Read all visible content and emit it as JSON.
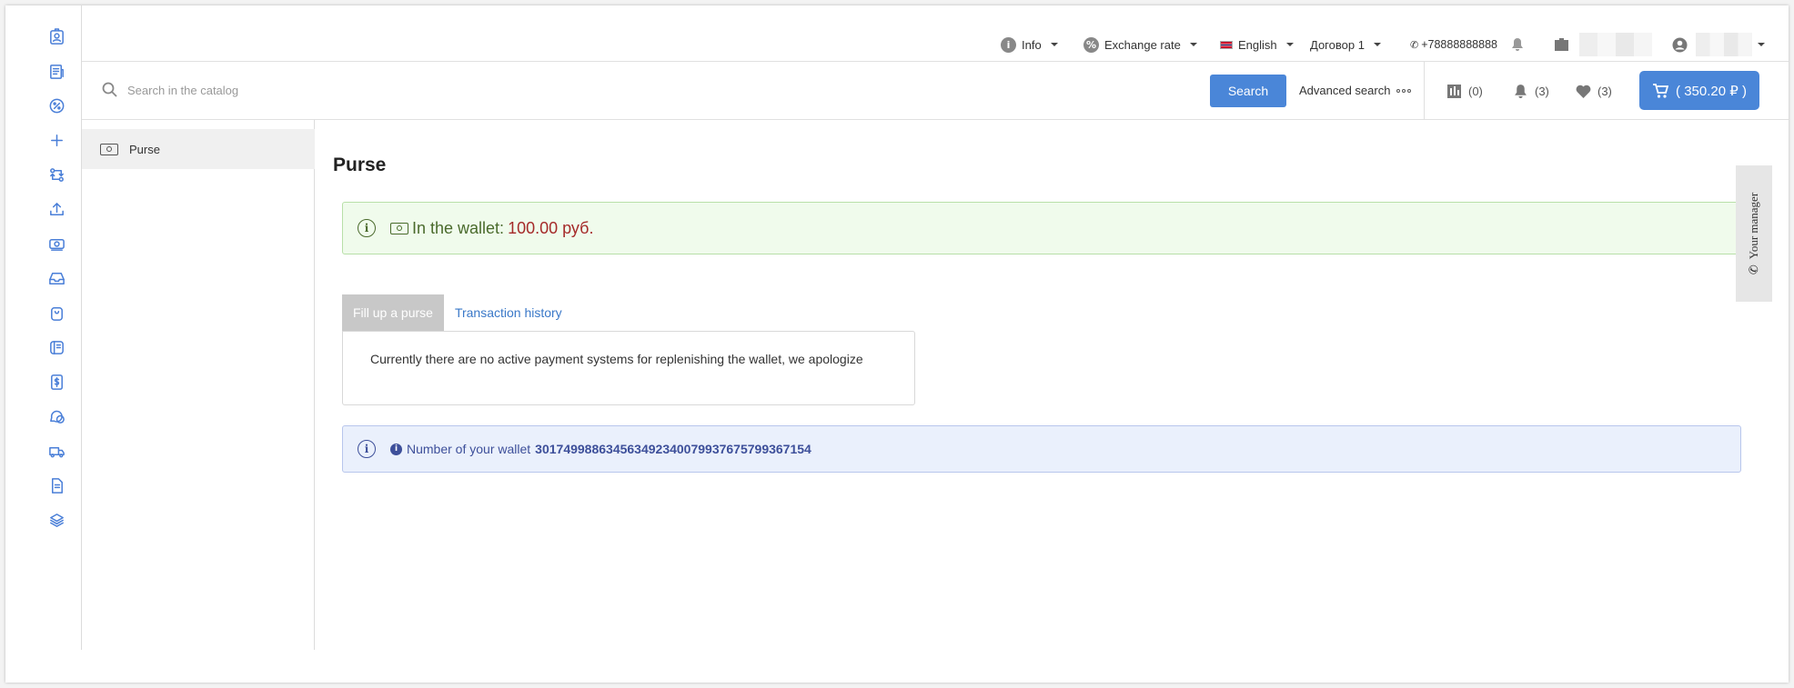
{
  "topbar": {
    "info_label": "Info",
    "exchange_label": "Exchange rate",
    "language_label": "English",
    "contract_label": "Договор 1",
    "phone": "+78888888888"
  },
  "search": {
    "placeholder": "Search in the catalog",
    "button_label": "Search",
    "advanced_label": "Advanced search"
  },
  "counters": {
    "compare": "(0)",
    "notifications": "(3)",
    "favorites": "(3)"
  },
  "cart": {
    "label": "( 350.20 ₽ )"
  },
  "sidebar": {
    "items": [
      {
        "label": "Purse"
      }
    ]
  },
  "page": {
    "title": "Purse",
    "wallet_prefix": "In the wallet:",
    "wallet_amount": "100.00 руб.",
    "tabs": [
      {
        "label": "Fill up a purse"
      },
      {
        "label": "Transaction history"
      }
    ],
    "tab_message": "Currently there are no active payment systems for replenishing the wallet, we apologize",
    "wallet_number_label": "Number of your wallet",
    "wallet_number": "301749988634563492340079937675799367154"
  },
  "manager": {
    "label": "Your manager"
  },
  "colors": {
    "accent": "#4a86d8",
    "success_bg": "#f0fbec",
    "info_bg": "#eaf0fc",
    "amount": "#a52a2a"
  },
  "rail_icons": [
    "user-badge-icon",
    "document-list-icon",
    "discount-icon",
    "plus-icon",
    "exchange-icon",
    "upload-icon",
    "cash-icon",
    "inbox-icon",
    "bag-icon",
    "catalog-icon",
    "invoice-icon",
    "chat-icon",
    "truck-icon",
    "file-icon",
    "layers-icon"
  ]
}
